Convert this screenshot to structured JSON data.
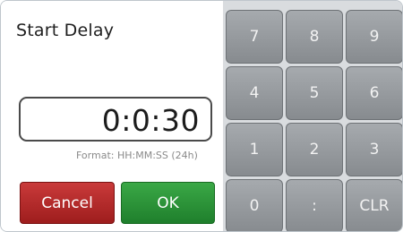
{
  "dialog": {
    "title": "Start Delay",
    "time_value": "0:0:30",
    "format_hint": "Format: HH:MM:SS (24h)"
  },
  "buttons": {
    "cancel_label": "Cancel",
    "ok_label": "OK"
  },
  "keypad": {
    "keys": [
      "7",
      "8",
      "9",
      "4",
      "5",
      "6",
      "1",
      "2",
      "3",
      "0",
      ":",
      "CLR"
    ]
  },
  "colors": {
    "cancel": "#b02a2a",
    "ok": "#2e9a3c",
    "key": "#9a9ea2"
  }
}
